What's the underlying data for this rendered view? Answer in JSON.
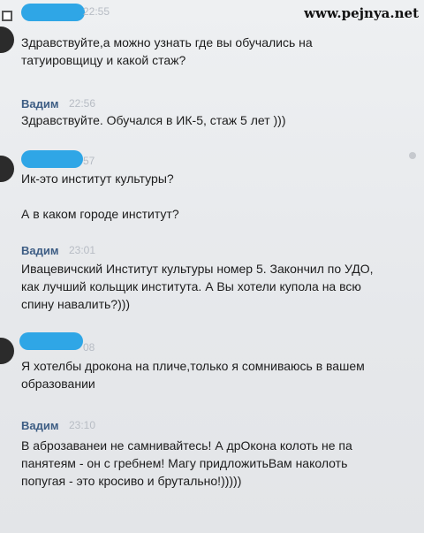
{
  "watermark": "www.pejnya.net",
  "messages": [
    {
      "id": "m1",
      "author": "",
      "time": "22:55",
      "lines": [
        "Здравствуйте,а можно узнать где вы обучались на",
        "татуировщицу и какой стаж?"
      ]
    },
    {
      "id": "m2",
      "author": "Вадим",
      "time": "22:56",
      "lines": [
        "Здравствуйте. Обучался в ИК-5, стаж 5 лет )))"
      ]
    },
    {
      "id": "m3",
      "author": "",
      "time": "57",
      "lines": [
        "Ик-это институт культуры?",
        "",
        "А в каком городе институт?"
      ]
    },
    {
      "id": "m4",
      "author": "Вадим",
      "time": "23:01",
      "lines": [
        "Ивацевичский Институт культуры номер 5. Закончил по УДО,",
        "как лучший кольщик института. А Вы хотели купола на всю",
        "спину навалить?)))"
      ]
    },
    {
      "id": "m5",
      "author": "",
      "time": "08",
      "lines": [
        "Я хотелбы дрокона на пличе,только я сомниваюсь в вашем",
        "образовании"
      ]
    },
    {
      "id": "m6",
      "author": "Вадим",
      "time": "23:10",
      "lines": [
        "В аброзаванеи не самнивайтесь! А дрОкона колоть не па",
        "панятеям - он с гребнем! Магу придложитьВам наколоть",
        "попугая - это кросиво и брутально!)))))"
      ]
    }
  ]
}
